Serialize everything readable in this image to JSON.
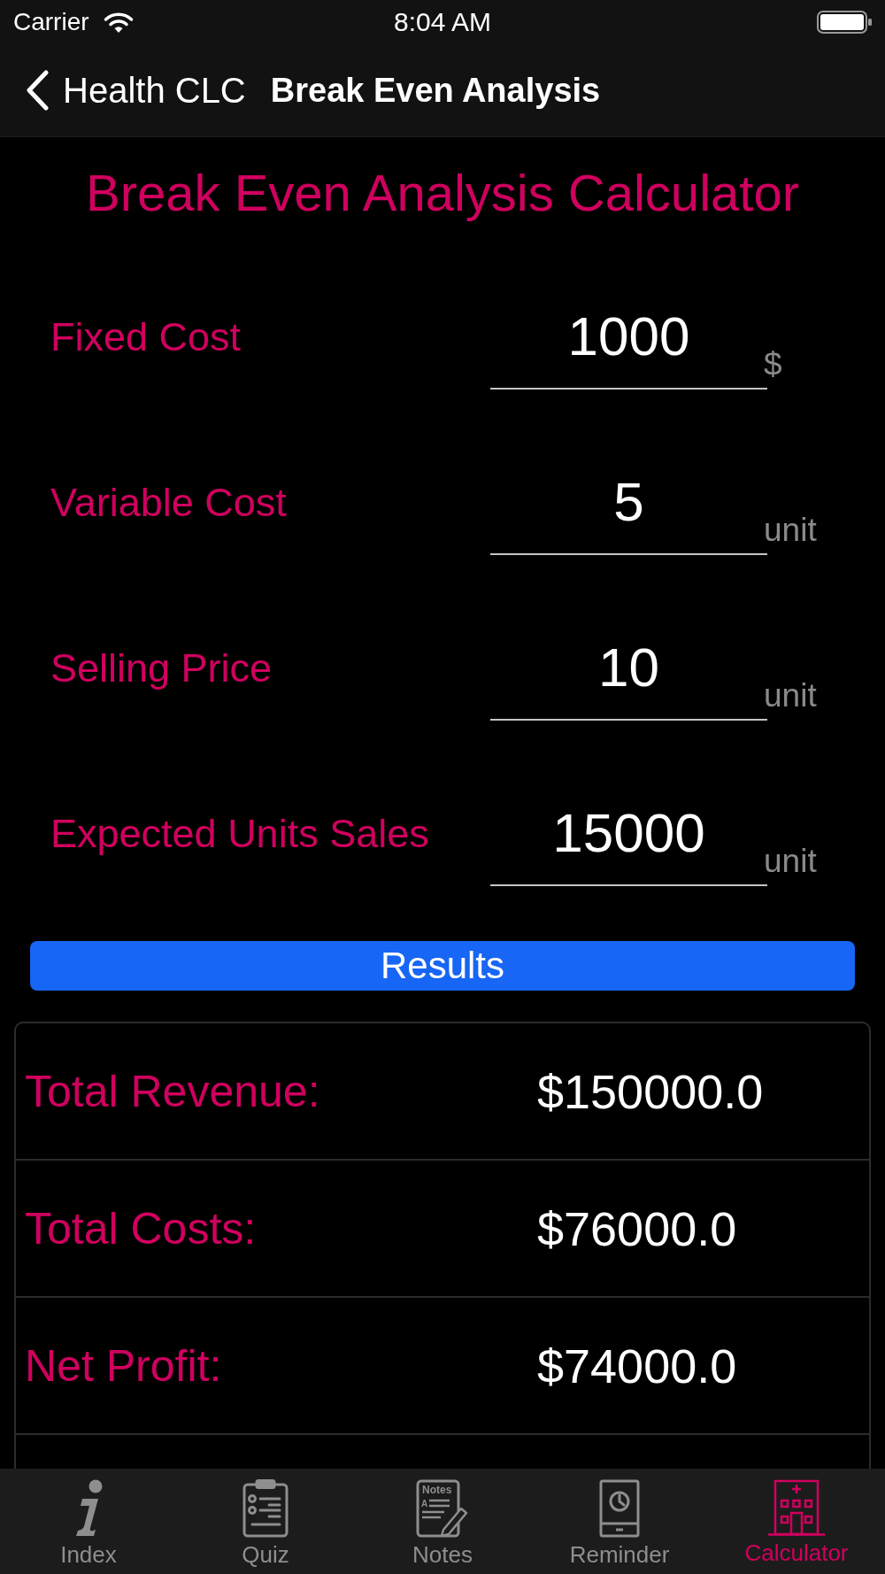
{
  "status_bar": {
    "carrier": "Carrier",
    "time": "8:04 AM"
  },
  "nav_bar": {
    "back_label": "Health CLC",
    "title": "Break Even Analysis"
  },
  "heading": "Break Even Analysis Calculator",
  "fields": [
    {
      "label": "Fixed Cost",
      "value": "1000",
      "unit": "$"
    },
    {
      "label": "Variable Cost",
      "value": "5",
      "unit": "unit"
    },
    {
      "label": "Selling Price",
      "value": "10",
      "unit": "unit"
    },
    {
      "label": "Expected Units Sales",
      "value": "15000",
      "unit": "unit"
    }
  ],
  "results_button": "Results",
  "results": [
    {
      "label": "Total Revenue:",
      "value": "$150000.0"
    },
    {
      "label": "Total Costs:",
      "value": "$76000.0"
    },
    {
      "label": "Net Profit:",
      "value": "$74000.0"
    }
  ],
  "tab_bar": [
    {
      "label": "Index",
      "kind": "info",
      "selected": false
    },
    {
      "label": "Quiz",
      "kind": "quiz",
      "selected": false
    },
    {
      "label": "Notes",
      "kind": "notes",
      "selected": false,
      "icon_title": "Notes",
      "icon_letter": "A"
    },
    {
      "label": "Reminder",
      "kind": "reminder",
      "selected": false
    },
    {
      "label": "Calculator",
      "kind": "calculator",
      "selected": true
    }
  ]
}
